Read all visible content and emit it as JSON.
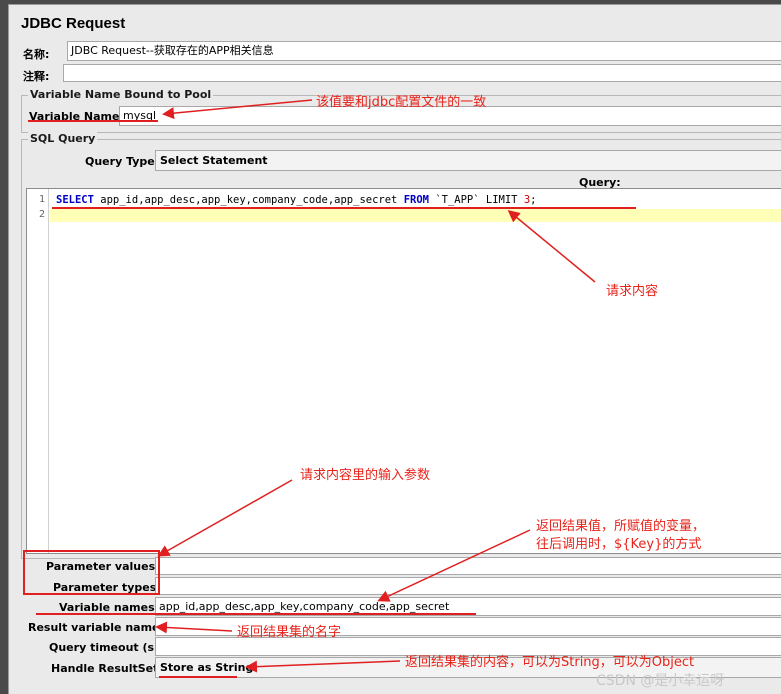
{
  "title": "JDBC Request",
  "name_label": "名称:",
  "name_value": "JDBC Request--获取存在的APP相关信息",
  "comment_label": "注释:",
  "comment_value": "",
  "pool": {
    "legend": "Variable Name Bound to Pool",
    "var_label": "Variable Name:",
    "var_value": "mysql"
  },
  "sql": {
    "legend": "SQL Query",
    "query_type_label": "Query Type:",
    "query_type_value": "Select Statement",
    "query_label": "Query:",
    "line1_no": "1",
    "line2_no": "2",
    "kw_select": "SELECT",
    "cols": " app_id,app_desc,app_key,company_code,app_secret ",
    "kw_from": "FROM",
    "table": " `T_APP` LIMIT ",
    "limit": "3",
    "semicolon": ";"
  },
  "params": {
    "values_label": "Parameter values:",
    "values_value": "",
    "types_label": "Parameter types:",
    "types_value": "",
    "varnames_label": "Variable names:",
    "varnames_value": "app_id,app_desc,app_key,company_code,app_secret",
    "result_label": "Result variable name:",
    "result_value": "",
    "timeout_label": "Query timeout (s):",
    "timeout_value": "",
    "handle_label": "Handle ResultSet:",
    "handle_value": "Store as String"
  },
  "annotations": {
    "pool": "该值要和jdbc配置文件的一致",
    "query": "请求内容",
    "params": "请求内容里的输入参数",
    "varnames_1": "返回结果值，所赋值的变量，",
    "varnames_2": "往后调用时，${Key}的方式",
    "result": "返回结果集的名字",
    "handle": "返回结果集的内容，可以为String，可以为Object"
  },
  "watermark": "CSDN @是小幸运呀",
  "colors": {
    "annotation": "#e8231a",
    "keyword": "#0000c8",
    "highlight": "#ffffb8"
  }
}
